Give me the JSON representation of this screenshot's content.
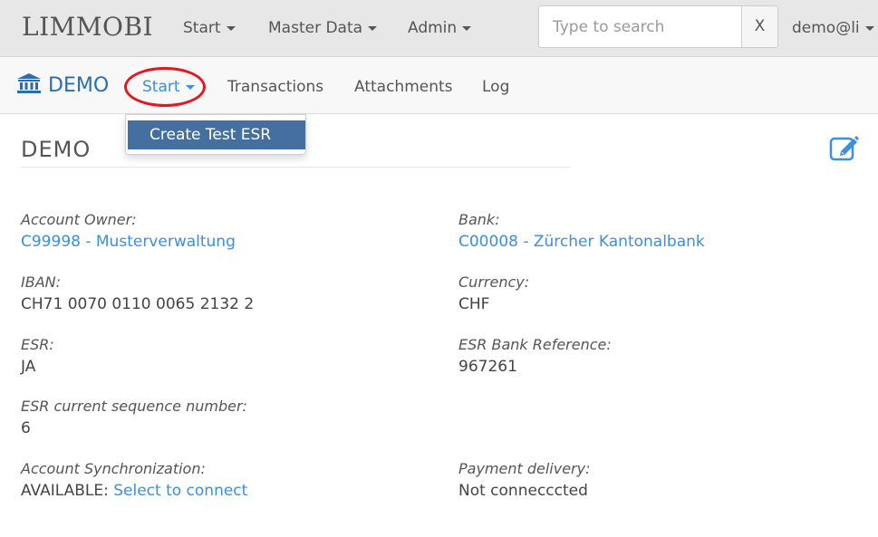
{
  "topnav": {
    "brand": "LIMMOBI",
    "items": [
      {
        "label": "Start"
      },
      {
        "label": "Master Data"
      },
      {
        "label": "Admin"
      }
    ],
    "search_placeholder": "Type to search",
    "search_clear": "X",
    "user": "demo@li"
  },
  "subnav": {
    "brand": "DEMO",
    "items": [
      {
        "label": "Start"
      },
      {
        "label": "Transactions"
      },
      {
        "label": "Attachments"
      },
      {
        "label": "Log"
      }
    ],
    "dropdown_items": [
      {
        "label": "Create Test ESR"
      }
    ]
  },
  "page": {
    "title": "DEMO",
    "fields": {
      "account_owner": {
        "label": "Account Owner:",
        "value": "C99998 - Musterverwaltung"
      },
      "bank": {
        "label": "Bank:",
        "value": "C00008 - Zürcher Kantonalbank"
      },
      "iban": {
        "label": "IBAN:",
        "value": "CH71 0070 0110 0065 2132 2"
      },
      "currency": {
        "label": "Currency:",
        "value": "CHF"
      },
      "esr": {
        "label": "ESR:",
        "value": "JA"
      },
      "esr_bank_ref": {
        "label": "ESR Bank Reference:",
        "value": "967261"
      },
      "esr_seq": {
        "label": "ESR current sequence number:",
        "value": "6"
      },
      "account_sync": {
        "label": "Account Synchronization:",
        "status": "AVAILABLE:",
        "link": "Select to connect"
      },
      "payment_delivery": {
        "label": "Payment delivery:",
        "value": "Not connecccted"
      }
    }
  },
  "colors": {
    "link": "#3a8ee6",
    "brand_blue": "#2a6db5",
    "dropdown_active": "#456f9f",
    "highlight": "#e8141e"
  }
}
